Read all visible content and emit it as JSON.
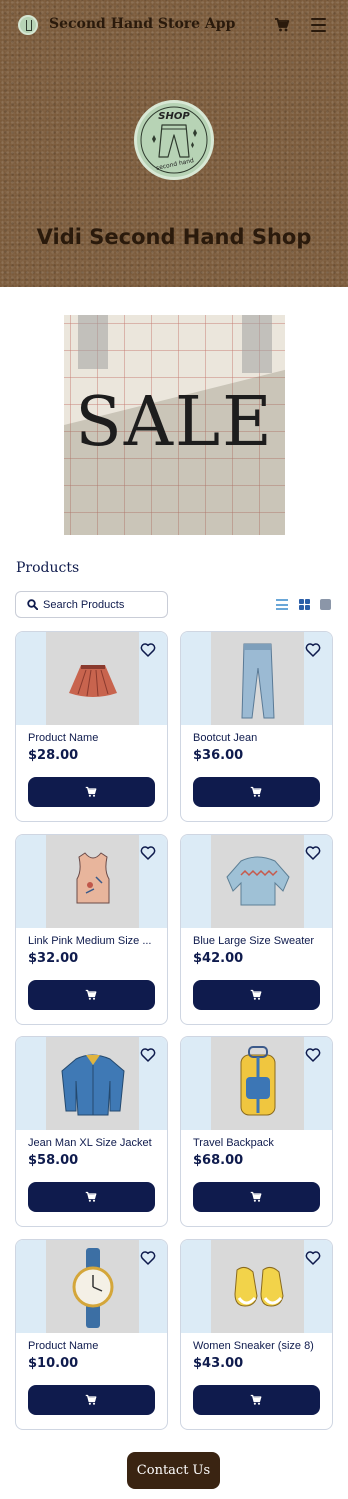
{
  "app": {
    "title": "Second Hand Store App"
  },
  "nav": {
    "cart_icon": "cart-icon",
    "menu_icon": "hamburger-menu-icon"
  },
  "hero": {
    "badge_top": "SHOP",
    "badge_bottom": "second hand",
    "title": "Vidi Second Hand Shop"
  },
  "sale_banner": {
    "text": "SALE"
  },
  "products_section": {
    "heading": "Products",
    "search": {
      "placeholder": "Search Products",
      "value": ""
    },
    "view_icons": [
      "list-view-icon",
      "grid-view-icon",
      "single-view-icon"
    ]
  },
  "products": [
    {
      "name": "Product Name",
      "price": "$28.00",
      "image": "skirt"
    },
    {
      "name": "Bootcut Jean",
      "price": "$36.00",
      "image": "jeans"
    },
    {
      "name": "Link Pink Medium Size ...",
      "price": "$32.00",
      "image": "tank-top"
    },
    {
      "name": "Blue Large Size Sweater",
      "price": "$42.00",
      "image": "sweater"
    },
    {
      "name": "Jean Man XL Size Jacket",
      "price": "$58.00",
      "image": "denim-jacket"
    },
    {
      "name": "Travel Backpack",
      "price": "$68.00",
      "image": "backpack"
    },
    {
      "name": "Product Name",
      "price": "$10.00",
      "image": "watch"
    },
    {
      "name": "Women Sneaker (size 8)",
      "price": "$43.00",
      "image": "sneakers"
    }
  ],
  "footer": {
    "contact_label": "Contact Us"
  },
  "colors": {
    "navy": "#0f1b4d",
    "hero_brown": "#7a5a3a",
    "contact_brown": "#3a2412",
    "badge_green": "#b7d3b5",
    "card_bg_blue": "#dcebf6"
  }
}
